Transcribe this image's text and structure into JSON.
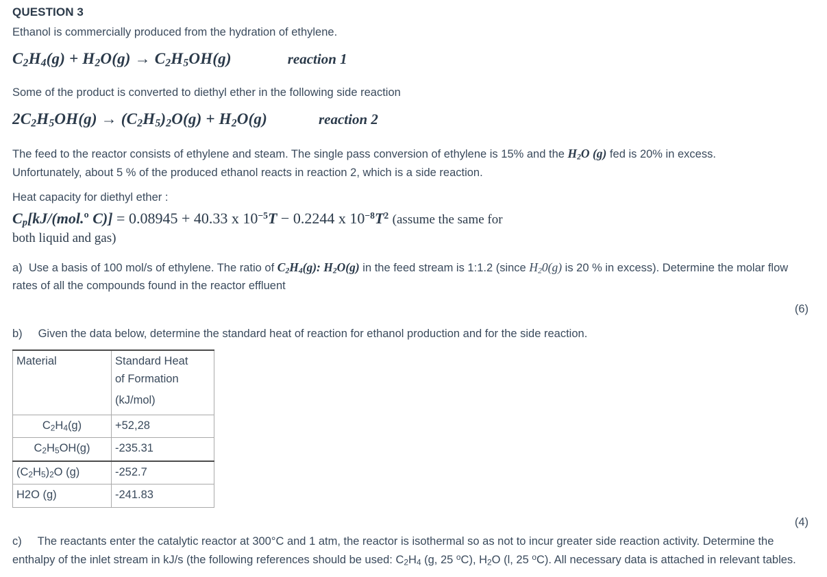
{
  "question": {
    "title": "QUESTION 3",
    "intro": "Ethanol is commercially produced from the hydration of ethylene."
  },
  "reaction1": {
    "equation_plain": "C2H4(g) + H2O(g) → C2H5OH(g)",
    "label": "reaction 1"
  },
  "side_reaction_intro": "Some of the product is converted to diethyl ether in the following side reaction",
  "reaction2": {
    "equation_plain": "2C2H5OH(g) → (C2H5)2O(g) + H2O(g)",
    "label": "reaction 2"
  },
  "feed_paragraph": {
    "line1_a": "The feed to the reactor consists of ethylene and steam. The single pass conversion of ethylene is 15% and the ",
    "inline_formula": "H2O (g)",
    "line1_b": " fed is 20% in excess.",
    "line2": "Unfortunately, about 5 % of the produced ethanol reacts in reaction 2, which is a side reaction."
  },
  "heat_capacity": {
    "heading": "Heat capacity for diethyl ether :",
    "formula_plain": "Cp[kJ/(mol.° C)] = 0.08945 + 40.33 x 10−5T − 0.2244 x 10−8T2",
    "coefficient_a": "0.08945",
    "coefficient_b": "40.33",
    "coefficient_b_exp": "−5",
    "coefficient_c": "0.2244",
    "coefficient_c_exp": "−8",
    "units": "kJ/(mol.° C)",
    "note": "(assume the same for both liquid and gas)",
    "note_line1": "(assume the same for",
    "note_line2": "both liquid and gas)"
  },
  "part_a": {
    "label": "a)",
    "text_1": "Use a basis of 100 mol/s of ethylene. The ratio of ",
    "ratio_formula": "C2H4(g): H2O(g)",
    "text_2": " in the feed stream is 1:1.2 (since ",
    "excess_formula": "H20(g)",
    "text_3": " is 20 % in excess). Determine the molar flow rates of all the compounds found in the reactor effluent",
    "marks": "(6)"
  },
  "part_b": {
    "label": "b)",
    "text": "Given the data below, determine the standard heat of reaction for ethanol production and for the side reaction.",
    "marks": "(4)",
    "table": {
      "headers": {
        "col1": "Material",
        "col2_line1": "Standard Heat",
        "col2_line2": "of Formation",
        "col2_line3": "(kJ/mol)"
      },
      "rows": [
        {
          "material_plain": "C2H4(g)",
          "value": "+52,28",
          "indent": true
        },
        {
          "material_plain": "C2H5OH(g)",
          "value": "-235.31",
          "indent": true
        },
        {
          "material_plain": "(C2H5)2O (g)",
          "value": "-252.7",
          "indent": false
        },
        {
          "material_plain": "H2O (g)",
          "value": "-241.83",
          "indent": false
        }
      ]
    }
  },
  "part_c": {
    "label": "c)",
    "text_1": "The reactants enter the catalytic reactor at 300°C and 1 atm, the reactor is isothermal so as not to incur greater side reaction activity. Determine the enthalpy of the inlet stream in kJ/s (the following references should be used: ",
    "ref_1": "C2H4 (g, 25 °C)",
    "text_2": ", ",
    "ref_2": "H2O (l, 25 °C)",
    "text_3": ". All necessary data is attached in relevant tables."
  },
  "colors": {
    "text": "#3a4a5c",
    "heading": "#2b3a4a",
    "table_border": "#a9a9a9",
    "table_border_strong": "#4a4a4a",
    "background": "#ffffff"
  }
}
